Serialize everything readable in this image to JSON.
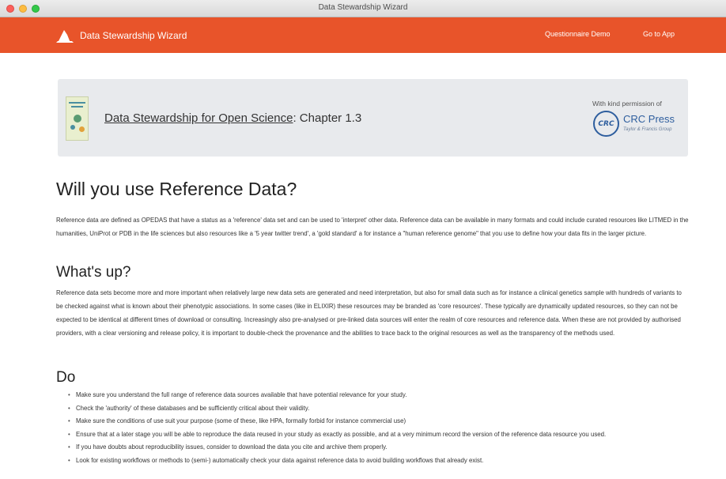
{
  "window": {
    "title": "Data Stewardship Wizard"
  },
  "navbar": {
    "brand": "Data Stewardship Wizard",
    "links": [
      "Questionnaire Demo",
      "Go to App"
    ],
    "color": "#e8542a"
  },
  "book": {
    "title_link": "Data Stewardship for Open Science",
    "chapter": ": Chapter 1.3",
    "permission": "With kind permission of",
    "publisher_mark": "CRC",
    "publisher": "CRC Press",
    "publisher_sub": "Taylor & Francis Group"
  },
  "page": {
    "heading": "Will you use Reference Data?",
    "intro": "Reference data are defined as OPEDAS that have a status as a 'reference' data set and can be used to 'interpret' other data. Reference data can be available in many formats and could include curated resources like LITMED in the humanities, UniProt or PDB in the life sciences but also resources like a '5 year twitter trend', a 'gold standard' a for instance a \"human reference genome\" that you use to define how your data fits in the larger picture.",
    "whats_up_heading": "What's up?",
    "whats_up": "Reference data sets become more and more important when relatively large new data sets are generated and need interpretation, but also for small data such as for instance a clinical genetics sample with hundreds of variants to be checked against what is known about their phenotypic associations. In some cases (like in ELIXIR) these resources may be branded as 'core resources'. These typically are dynamically updated resources, so they can not be expected to be identical at different times of download or consulting. Increasingly also pre-analysed or pre-linked data sources will enter the realm of core resources and reference data. When these are not provided by authorised providers, with a clear versioning and release policy, it is important to double-check the provenance and the abilities to trace back to the original resources as well as the transparency of the methods used.",
    "do_heading": "Do",
    "do_items": [
      "Make sure you understand the full range of reference data sources available that have potential relevance for your study.",
      "Check the 'authority' of these databases and be sufficiently critical about their validity.",
      "Make sure the conditions of use suit your purpose (some of these, like HPA, formally forbid for instance commercial use)",
      "Ensure that at a later stage you will be able to reproduce the data reused in your study as exactly as possible, and at a very minimum record the version of the reference data resource you used.",
      "If you have doubts about reproducibility issues, consider to download the data you cite and archive them properly.",
      "Look for existing workflows or methods to (semi-) automatically check your data against reference data to avoid building workflows that already exist."
    ]
  }
}
